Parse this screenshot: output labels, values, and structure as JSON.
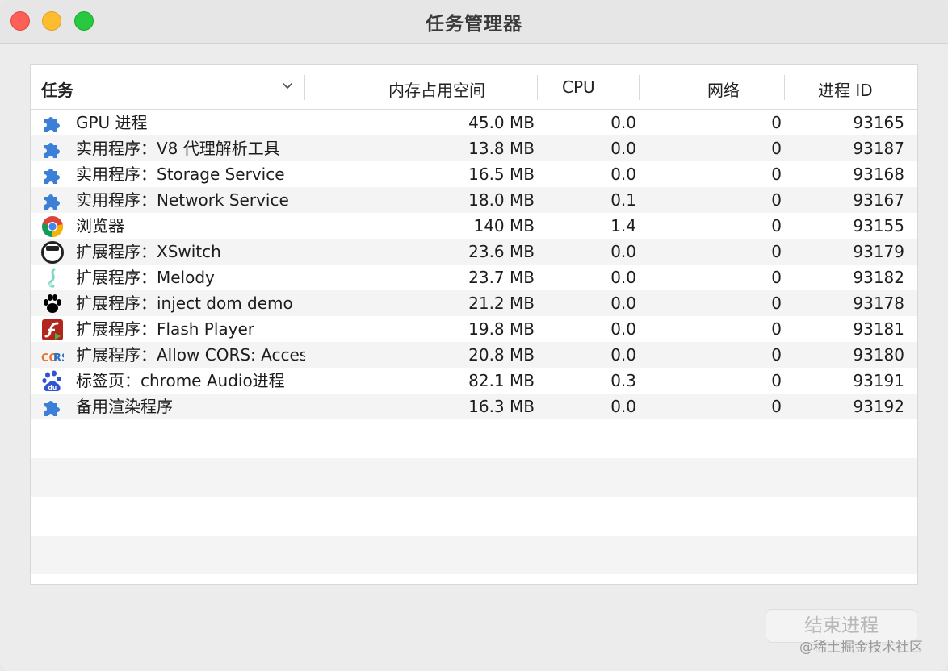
{
  "window": {
    "title": "任务管理器"
  },
  "table": {
    "headers": {
      "task": "任务",
      "memory": "内存占用空间",
      "cpu": "CPU",
      "network": "网络",
      "pid": "进程 ID"
    },
    "rows": [
      {
        "icon": "puzzle-piece-icon",
        "name": "GPU 进程",
        "memory": "45.0 MB",
        "cpu": "0.0",
        "network": "0",
        "pid": "93165"
      },
      {
        "icon": "puzzle-piece-icon",
        "name": "实用程序：V8 代理解析工具",
        "memory": "13.8 MB",
        "cpu": "0.0",
        "network": "0",
        "pid": "93187"
      },
      {
        "icon": "puzzle-piece-icon",
        "name": "实用程序：Storage Service",
        "memory": "16.5 MB",
        "cpu": "0.0",
        "network": "0",
        "pid": "93168"
      },
      {
        "icon": "puzzle-piece-icon",
        "name": "实用程序：Network Service",
        "memory": "18.0 MB",
        "cpu": "0.1",
        "network": "0",
        "pid": "93167"
      },
      {
        "icon": "chrome-icon",
        "name": "浏览器",
        "memory": "140 MB",
        "cpu": "1.4",
        "network": "0",
        "pid": "93155"
      },
      {
        "icon": "xswitch-icon",
        "name": "扩展程序：XSwitch",
        "memory": "23.6 MB",
        "cpu": "0.0",
        "network": "0",
        "pid": "93179"
      },
      {
        "icon": "melody-icon",
        "name": "扩展程序：Melody",
        "memory": "23.7 MB",
        "cpu": "0.0",
        "network": "0",
        "pid": "93182"
      },
      {
        "icon": "paw-icon",
        "name": "扩展程序：inject dom demo",
        "memory": "21.2 MB",
        "cpu": "0.0",
        "network": "0",
        "pid": "93178"
      },
      {
        "icon": "flash-icon",
        "name": "扩展程序：Flash Player",
        "memory": "19.8 MB",
        "cpu": "0.0",
        "network": "0",
        "pid": "93181"
      },
      {
        "icon": "cors-icon",
        "name": "扩展程序：Allow CORS: Access",
        "memory": "20.8 MB",
        "cpu": "0.0",
        "network": "0",
        "pid": "93180"
      },
      {
        "icon": "baidu-icon",
        "name": "标签页：chrome Audio进程",
        "memory": "82.1 MB",
        "cpu": "0.3",
        "network": "0",
        "pid": "93191"
      },
      {
        "icon": "puzzle-piece-icon",
        "name": "备用渲染程序",
        "memory": "16.3 MB",
        "cpu": "0.0",
        "network": "0",
        "pid": "93192"
      }
    ]
  },
  "end_button": "结束进程",
  "watermark": "@稀土掘金技术社区",
  "colors": {
    "puzzle": "#3b7fd6",
    "close": "#fe5f57",
    "minimize": "#febc2e",
    "maximize": "#28c840"
  }
}
